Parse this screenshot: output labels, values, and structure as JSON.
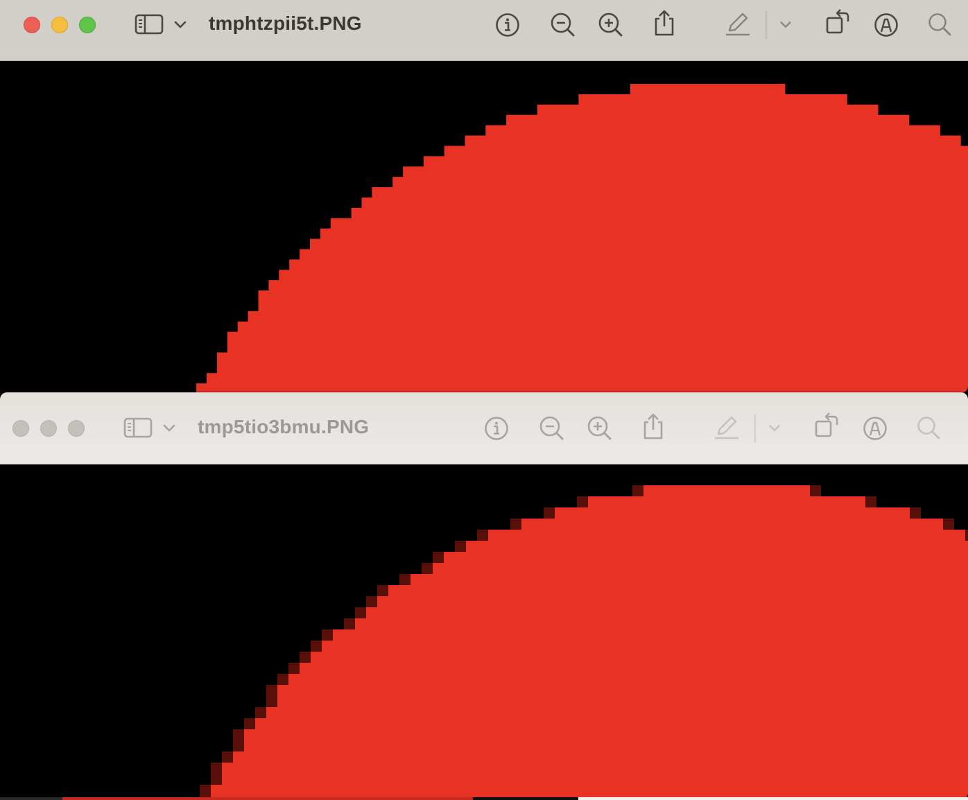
{
  "windows": [
    {
      "title": "tmphtzpii5t.PNG",
      "active": true,
      "toolbar_icons": [
        "sidebar-icon",
        "chevron-down-icon",
        "info-icon",
        "zoom-out-icon",
        "zoom-in-icon",
        "share-icon",
        "markup-pen-icon",
        "chevron-down-icon",
        "rotate-icon",
        "annotate-icon",
        "search-icon"
      ],
      "image": {
        "description_colors": {
          "background": "#000000",
          "shape": "#e83224"
        },
        "antialiased": false
      }
    },
    {
      "title": "tmp5tio3bmu.PNG",
      "active": false,
      "toolbar_icons": [
        "sidebar-icon",
        "chevron-down-icon",
        "info-icon",
        "zoom-out-icon",
        "zoom-in-icon",
        "share-icon",
        "markup-pen-icon",
        "chevron-down-icon",
        "rotate-icon",
        "annotate-icon",
        "search-icon"
      ],
      "image": {
        "description_colors": {
          "background": "#000000",
          "shape": "#e83224",
          "edge": "#5a0f0b"
        },
        "antialiased": true
      }
    }
  ]
}
